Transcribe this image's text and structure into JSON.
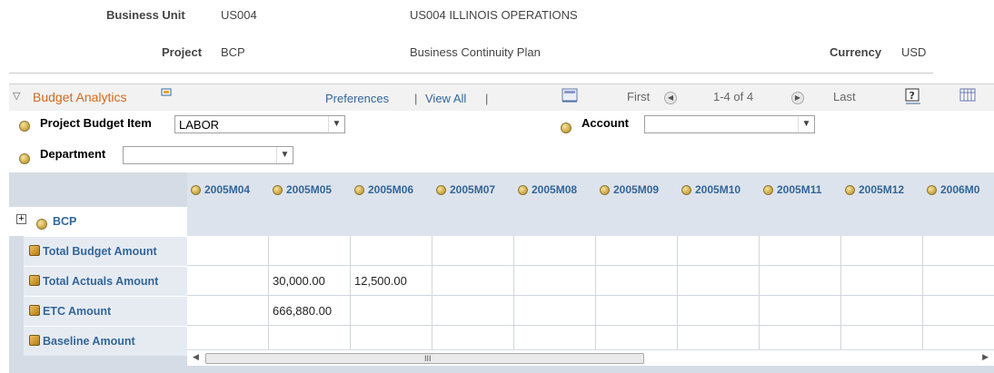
{
  "header": {
    "business_unit_label": "Business Unit",
    "business_unit_value": "US004",
    "business_unit_desc": "US004 ILLINOIS OPERATIONS",
    "project_label": "Project",
    "project_value": "BCP",
    "project_desc": "Business Continuity Plan",
    "currency_label": "Currency",
    "currency_value": "USD"
  },
  "section": {
    "title": "Budget Analytics",
    "preferences": "Preferences",
    "view_all": "View All",
    "first": "First",
    "range": "1-4 of 4",
    "last": "Last"
  },
  "prompts": {
    "project_budget_item_label": "Project Budget Item",
    "project_budget_item_value": "LABOR",
    "account_label": "Account",
    "account_value": "",
    "department_label": "Department",
    "department_value": ""
  },
  "grid": {
    "columns": [
      "2005M04",
      "2005M05",
      "2005M06",
      "2005M07",
      "2005M08",
      "2005M09",
      "2005M10",
      "2005M11",
      "2005M12",
      "2006M0"
    ],
    "group_label": "BCP",
    "rows": [
      {
        "label": "Total Budget Amount",
        "values": [
          "",
          "",
          "",
          "",
          "",
          "",
          "",
          "",
          "",
          ""
        ]
      },
      {
        "label": "Total Actuals Amount",
        "values": [
          "",
          "30,000.00",
          "12,500.00",
          "",
          "",
          "",
          "",
          "",
          "",
          ""
        ]
      },
      {
        "label": "ETC Amount",
        "values": [
          "",
          "666,880.00",
          "",
          "",
          "",
          "",
          "",
          "",
          "",
          ""
        ]
      },
      {
        "label": "Baseline Amount",
        "values": [
          "",
          "",
          "",
          "",
          "",
          "",
          "",
          "",
          "",
          ""
        ]
      }
    ]
  },
  "scrollbar": {
    "grip": "III"
  }
}
